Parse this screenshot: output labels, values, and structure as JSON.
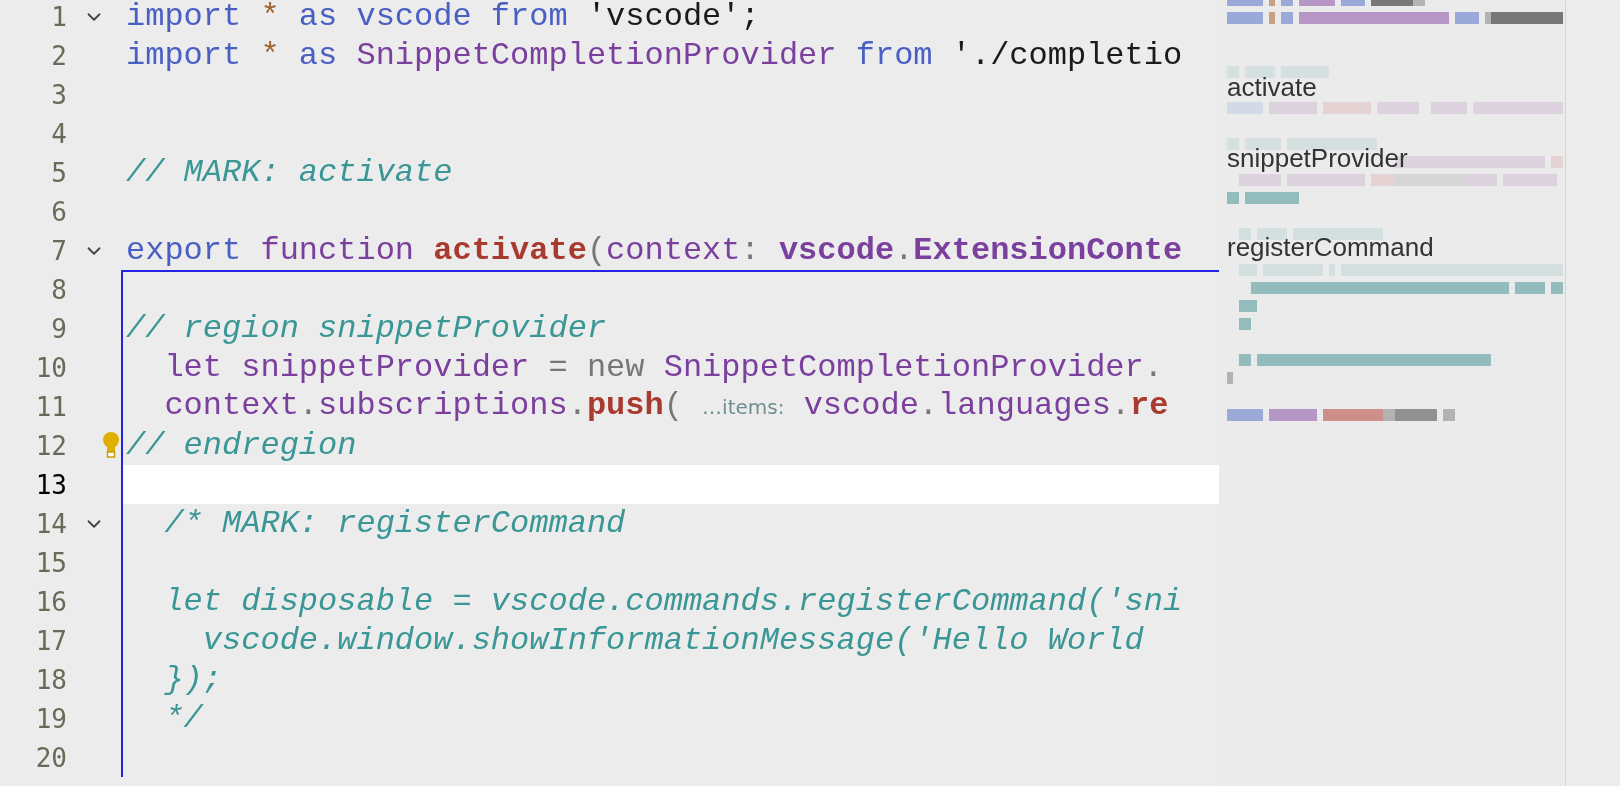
{
  "editor": {
    "lines": [
      {
        "number": "1",
        "foldable": true,
        "current": false,
        "boxed": false,
        "lightbulb": false,
        "tokens": [
          {
            "text": "import ",
            "kind": "keyword"
          },
          {
            "text": "*",
            "kind": "star"
          },
          {
            "text": " as vscode from ",
            "kind": "keyword"
          },
          {
            "text": "'vscode';",
            "kind": "string"
          }
        ]
      },
      {
        "number": "2",
        "foldable": false,
        "current": false,
        "boxed": false,
        "lightbulb": false,
        "tokens": [
          {
            "text": "import ",
            "kind": "keyword"
          },
          {
            "text": "*",
            "kind": "star"
          },
          {
            "text": " as ",
            "kind": "keyword"
          },
          {
            "text": "SnippetCompletionProvider",
            "kind": "variable"
          },
          {
            "text": " from ",
            "kind": "keyword"
          },
          {
            "text": "'./completio",
            "kind": "string"
          }
        ]
      },
      {
        "number": "3",
        "foldable": false,
        "current": false,
        "boxed": false,
        "lightbulb": false
      },
      {
        "number": "4",
        "foldable": false,
        "current": false,
        "boxed": false,
        "lightbulb": false
      },
      {
        "number": "5",
        "foldable": false,
        "current": false,
        "boxed": false,
        "lightbulb": false,
        "tokens": [
          {
            "text": "// MARK: activate",
            "kind": "comment"
          }
        ]
      },
      {
        "number": "6",
        "foldable": false,
        "current": false,
        "boxed": false,
        "lightbulb": false
      },
      {
        "number": "7",
        "foldable": true,
        "current": false,
        "boxed": false,
        "lightbulb": false,
        "tokens": [
          {
            "text": "export",
            "kind": "keyword"
          },
          {
            "text": " function ",
            "kind": "variable"
          },
          {
            "text": "activate",
            "kind": "function"
          },
          {
            "text": "(",
            "kind": "operator"
          },
          {
            "text": "context",
            "kind": "variable"
          },
          {
            "text": ": ",
            "kind": "operator"
          },
          {
            "text": "vscode",
            "kind": "type"
          },
          {
            "text": ".",
            "kind": "operator"
          },
          {
            "text": "ExtensionConte",
            "kind": "type"
          }
        ]
      },
      {
        "number": "8",
        "foldable": false,
        "current": false,
        "boxed": true,
        "lightbulb": false
      },
      {
        "number": "9",
        "foldable": false,
        "current": false,
        "boxed": true,
        "lightbulb": false,
        "tokens": [
          {
            "text": "// region snippetProvider",
            "kind": "comment"
          }
        ]
      },
      {
        "number": "10",
        "foldable": false,
        "current": false,
        "boxed": true,
        "lightbulb": false,
        "tokens": [
          {
            "text": "  let snippetProvider ",
            "kind": "variable"
          },
          {
            "text": "= new ",
            "kind": "operator"
          },
          {
            "text": "SnippetCompletionProvider",
            "kind": "variable"
          },
          {
            "text": ".",
            "kind": "operator"
          }
        ]
      },
      {
        "number": "11",
        "foldable": false,
        "current": false,
        "boxed": true,
        "lightbulb": false,
        "tokens": [
          {
            "text": "  context",
            "kind": "variable"
          },
          {
            "text": ".",
            "kind": "operator"
          },
          {
            "text": "subscriptions",
            "kind": "variable"
          },
          {
            "text": ".",
            "kind": "operator"
          },
          {
            "text": "push",
            "kind": "function"
          },
          {
            "text": "( ",
            "kind": "operator"
          },
          {
            "text": "…items:",
            "kind": "hint"
          },
          {
            "text": " vscode",
            "kind": "variable"
          },
          {
            "text": ".",
            "kind": "operator"
          },
          {
            "text": "languages",
            "kind": "variable"
          },
          {
            "text": ".",
            "kind": "operator"
          },
          {
            "text": "re",
            "kind": "function"
          }
        ]
      },
      {
        "number": "12",
        "foldable": false,
        "current": false,
        "boxed": true,
        "lightbulb": true,
        "tokens": [
          {
            "text": "// endregion",
            "kind": "comment"
          }
        ]
      },
      {
        "number": "13",
        "foldable": false,
        "current": true,
        "boxed": true,
        "lightbulb": false
      },
      {
        "number": "14",
        "foldable": true,
        "current": false,
        "boxed": true,
        "lightbulb": false,
        "tokens": [
          {
            "text": "  /* MARK: registerCommand",
            "kind": "comment"
          }
        ]
      },
      {
        "number": "15",
        "foldable": false,
        "current": false,
        "boxed": true,
        "lightbulb": false
      },
      {
        "number": "16",
        "foldable": false,
        "current": false,
        "boxed": true,
        "lightbulb": false,
        "tokens": [
          {
            "text": "  let disposable = vscode.commands.registerCommand('sni",
            "kind": "comment"
          }
        ]
      },
      {
        "number": "17",
        "foldable": false,
        "current": false,
        "boxed": true,
        "lightbulb": false,
        "tokens": [
          {
            "text": "    vscode.window.showInformationMessage('Hello World",
            "kind": "comment"
          }
        ]
      },
      {
        "number": "18",
        "foldable": false,
        "current": false,
        "boxed": true,
        "lightbulb": false,
        "tokens": [
          {
            "text": "  });",
            "kind": "comment"
          }
        ]
      },
      {
        "number": "19",
        "foldable": false,
        "current": false,
        "boxed": true,
        "lightbulb": false,
        "tokens": [
          {
            "text": "  */",
            "kind": "comment"
          }
        ]
      },
      {
        "number": "20",
        "foldable": false,
        "current": false,
        "boxed": true,
        "lightbulb": false
      }
    ]
  },
  "minimap": {
    "section_labels": [
      "activate",
      "snippetProvider",
      "registerCommand"
    ]
  }
}
